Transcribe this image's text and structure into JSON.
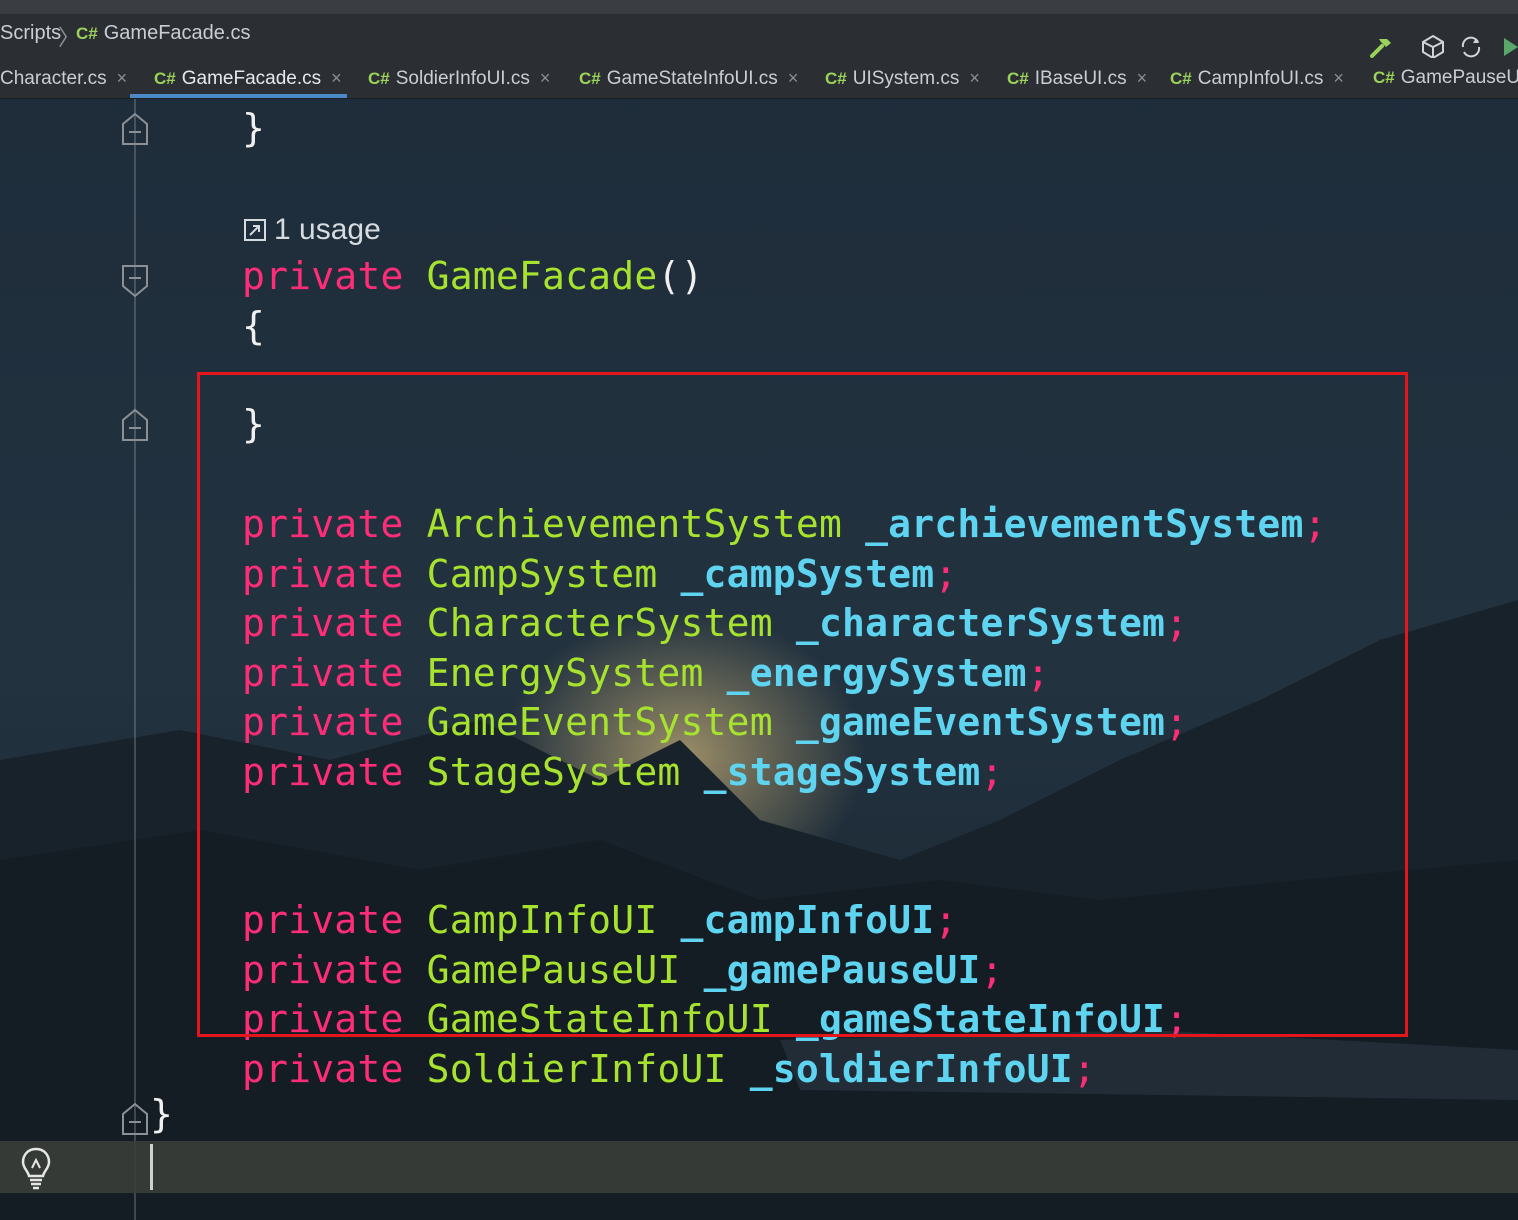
{
  "breadcrumb": {
    "folder": "Scripts",
    "lang": "C#",
    "file": "GameFacade.cs"
  },
  "toolbar": {
    "icons": [
      "hammer-icon",
      "unity-icon",
      "unity-refresh-icon",
      "run-icon"
    ]
  },
  "tabs": [
    {
      "lang": "",
      "label": "Character.cs",
      "active": false
    },
    {
      "lang": "C#",
      "label": "GameFacade.cs",
      "active": true
    },
    {
      "lang": "C#",
      "label": "SoldierInfoUI.cs",
      "active": false
    },
    {
      "lang": "C#",
      "label": "GameStateInfoUI.cs",
      "active": false
    },
    {
      "lang": "C#",
      "label": "UISystem.cs",
      "active": false
    },
    {
      "lang": "C#",
      "label": "IBaseUI.cs",
      "active": false
    },
    {
      "lang": "C#",
      "label": "CampInfoUI.cs",
      "active": false
    },
    {
      "lang": "C#",
      "label": "GamePauseUI",
      "active": false
    }
  ],
  "tab_close_glyph": "×",
  "code": {
    "closing_brace": "}",
    "usage_hint": "1 usage",
    "constructor": {
      "modifier": "private",
      "name": "GameFacade",
      "parens": "()",
      "open_brace": "{",
      "close_brace": "}"
    },
    "system_fields": [
      {
        "modifier": "private",
        "type": "ArchievementSystem",
        "name": "_archievementSystem",
        "punct": ";"
      },
      {
        "modifier": "private",
        "type": "CampSystem",
        "name": "_campSystem",
        "punct": ";"
      },
      {
        "modifier": "private",
        "type": "CharacterSystem",
        "name": "_characterSystem",
        "punct": ";"
      },
      {
        "modifier": "private",
        "type": "EnergySystem",
        "name": "_energySystem",
        "punct": ";"
      },
      {
        "modifier": "private",
        "type": "GameEventSystem",
        "name": "_gameEventSystem",
        "punct": ";"
      },
      {
        "modifier": "private",
        "type": "StageSystem",
        "name": "_stageSystem",
        "punct": ";"
      }
    ],
    "ui_fields": [
      {
        "modifier": "private",
        "type": "CampInfoUI",
        "name": "_campInfoUI",
        "punct": ";"
      },
      {
        "modifier": "private",
        "type": "GamePauseUI",
        "name": "_gamePauseUI",
        "punct": ";"
      },
      {
        "modifier": "private",
        "type": "GameStateInfoUI",
        "name": "_gameStateInfoUI",
        "punct": ";"
      },
      {
        "modifier": "private",
        "type": "SoldierInfoUI",
        "name": "_soldierInfoUI",
        "punct": ";"
      }
    ],
    "class_close_brace": "}"
  },
  "colors": {
    "keyword": "#ff2d78",
    "type": "#a6e22e",
    "field": "#5fd4f0",
    "highlight_border": "#e4161b"
  }
}
